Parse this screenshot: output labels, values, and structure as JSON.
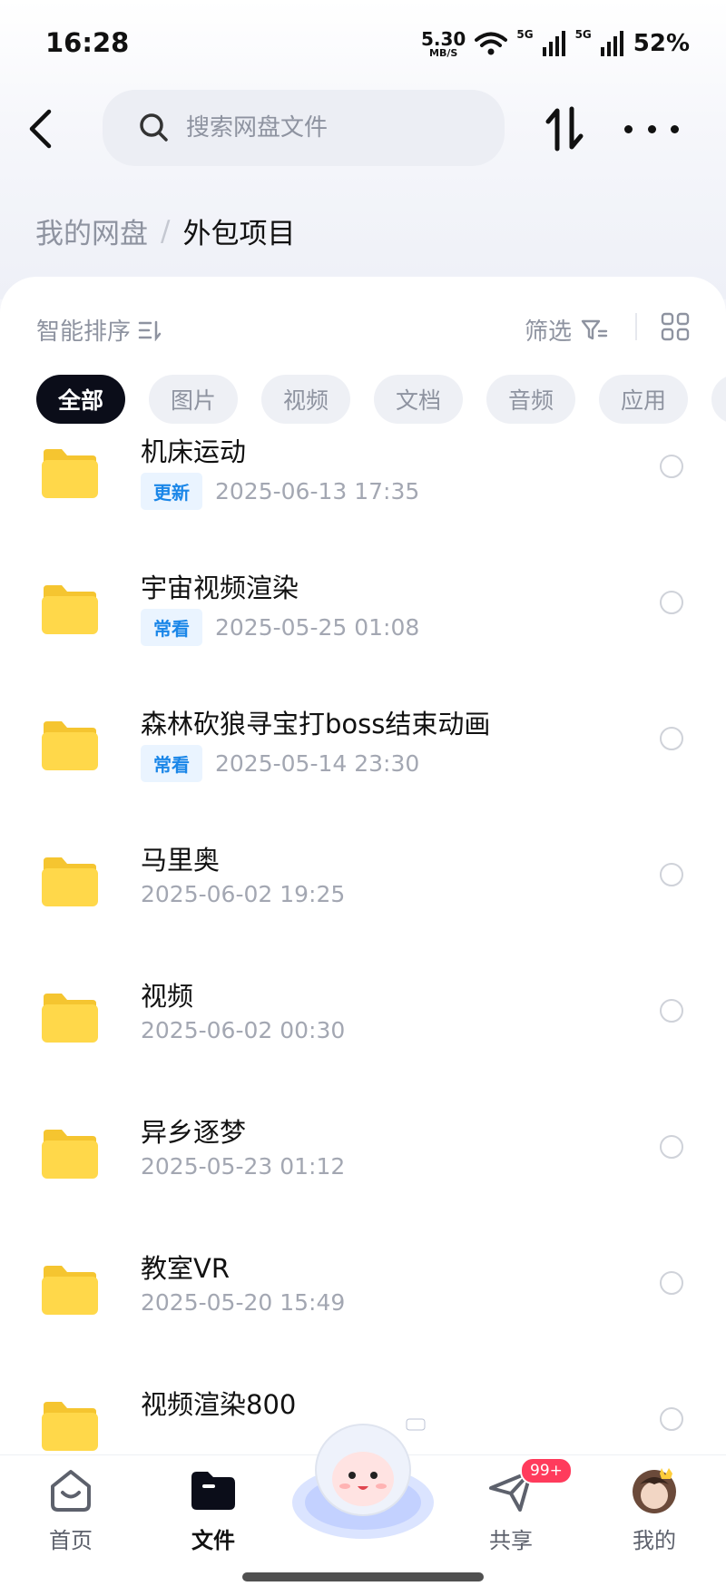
{
  "status": {
    "time": "16:28",
    "speed_value": "5.30",
    "speed_unit": "MB/S",
    "net1": "5G",
    "net2": "5G",
    "battery": "52%"
  },
  "search": {
    "placeholder": "搜索网盘文件"
  },
  "breadcrumb": {
    "root": "我的网盘",
    "separator": "/",
    "current": "外包项目"
  },
  "toolbar": {
    "sort_label": "智能排序",
    "filter_label": "筛选"
  },
  "chips": [
    "全部",
    "图片",
    "视频",
    "文档",
    "音频",
    "应用"
  ],
  "files": [
    {
      "name": "机床运动",
      "tag": "更新",
      "date": "2025-06-13  17:35"
    },
    {
      "name": "宇宙视频渲染",
      "tag": "常看",
      "date": "2025-05-25  01:08"
    },
    {
      "name": "森林砍狼寻宝打boss结束动画",
      "tag": "常看",
      "date": "2025-05-14  23:30"
    },
    {
      "name": "马里奥",
      "tag": "",
      "date": "2025-06-02  19:25"
    },
    {
      "name": "视频",
      "tag": "",
      "date": "2025-06-02  00:30"
    },
    {
      "name": "异乡逐梦",
      "tag": "",
      "date": "2025-05-23  01:12"
    },
    {
      "name": "教室VR",
      "tag": "",
      "date": "2025-05-20  15:49"
    },
    {
      "name": "视频渲染800",
      "tag": "",
      "date": ""
    }
  ],
  "nav": {
    "home": "首页",
    "files": "文件",
    "share": "共享",
    "share_badge": "99+",
    "mine": "我的"
  },
  "colors": {
    "accent_dark": "#0b0d19",
    "tag_blue": "#1a86e8",
    "folder_yellow": "#ffd84a",
    "badge_red": "#ff3b5c"
  },
  "icons": [
    "back-arrow-icon",
    "search-icon",
    "sort-icon",
    "more-icon",
    "sort-lines-icon",
    "filter-icon",
    "grid-view-icon",
    "folder-icon",
    "home-icon",
    "files-icon",
    "share-icon",
    "mascot"
  ]
}
